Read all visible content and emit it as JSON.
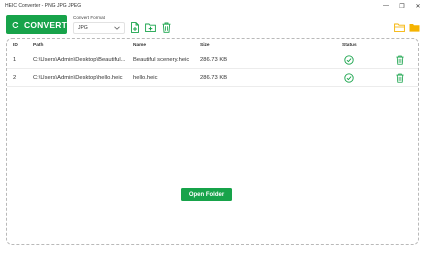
{
  "window": {
    "title": "HEIC Converter - PNG JPG JPEG",
    "minimize_glyph": "—",
    "maximize_glyph": "❐",
    "close_glyph": "✕"
  },
  "toolbar": {
    "convert_label": "CONVERT",
    "convert_icon": "refresh-icon",
    "format_label": "Convert Format",
    "format_value": "JPG",
    "add_file_icon": "add-file-icon",
    "add_folder_icon": "add-folder-icon",
    "clear_icon": "trash-icon",
    "open_folder_icon": "open-folder-icon",
    "folder_icon": "folder-icon"
  },
  "table": {
    "columns": {
      "id": "ID",
      "path": "Path",
      "name": "Name",
      "size": "Size",
      "status": "Status"
    },
    "rows": [
      {
        "id": "1",
        "path": "C:\\Users\\Admin\\Desktop\\Beautiful...",
        "name": "Beautiful scenery.heic",
        "size": "286.73 KB",
        "status": "done"
      },
      {
        "id": "2",
        "path": "C:\\Users\\Admin\\Desktop\\hello.heic",
        "name": "hello.heic",
        "size": "286.73 KB",
        "status": "done"
      }
    ]
  },
  "footer": {
    "open_folder_label": "Open Folder"
  },
  "colors": {
    "accent": "#17a34a",
    "folder": "#f5b301"
  }
}
